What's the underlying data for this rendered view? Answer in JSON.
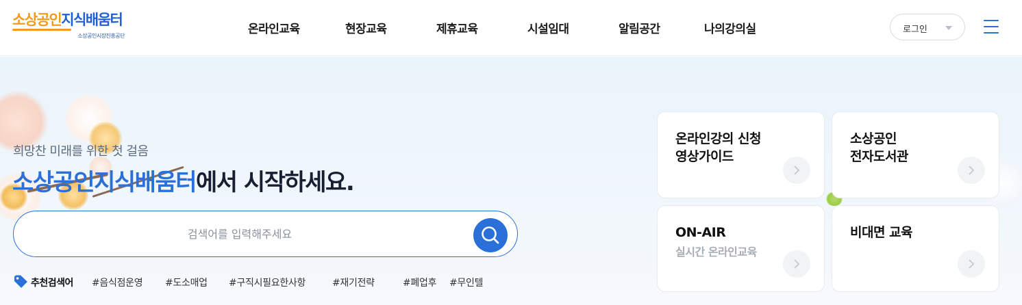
{
  "header": {
    "logo": {
      "main_orange": "소상공인",
      "main_blue": "지식배움터",
      "sub": "소상공인시장진흥공단"
    },
    "nav": [
      "온라인교육",
      "현장교육",
      "제휴교육",
      "시설임대",
      "알림공간",
      "나의강의실"
    ],
    "login_label": "로그인",
    "icons": {
      "menu": "hamburger-menu-icon",
      "login_caret": "chevron-down-icon"
    }
  },
  "hero": {
    "subtitle": "희망찬 미래를 위한 첫 걸음",
    "headline_highlight": "소상공인지식배움터",
    "headline_rest": "에서 시작하세요.",
    "search_placeholder": "검색어를 입력해주세요",
    "tags_title": "추천검색어",
    "tags": [
      "#음식점운영",
      "#도소매업",
      "#구직시필요한사항",
      "#재기전략",
      "#폐업후",
      "#무인텔"
    ],
    "icons": {
      "search": "search-icon",
      "tag": "tag-icon",
      "card_arrow": "chevron-right-icon"
    }
  },
  "cards": [
    {
      "title_line1": "온라인강의 신청",
      "title_line2": "영상가이드",
      "subtitle": ""
    },
    {
      "title_line1": "소상공인",
      "title_line2": "전자도서관",
      "subtitle": ""
    },
    {
      "title_line1": "ON-AIR",
      "title_line2": "",
      "subtitle": "실시간 온라인교육"
    },
    {
      "title_line1": "비대면 교육",
      "title_line2": "",
      "subtitle": ""
    }
  ],
  "colors": {
    "brand_blue": "#2b6fd9",
    "brand_orange": "#f29a1a",
    "hero_bg": "#eaf4fb"
  }
}
